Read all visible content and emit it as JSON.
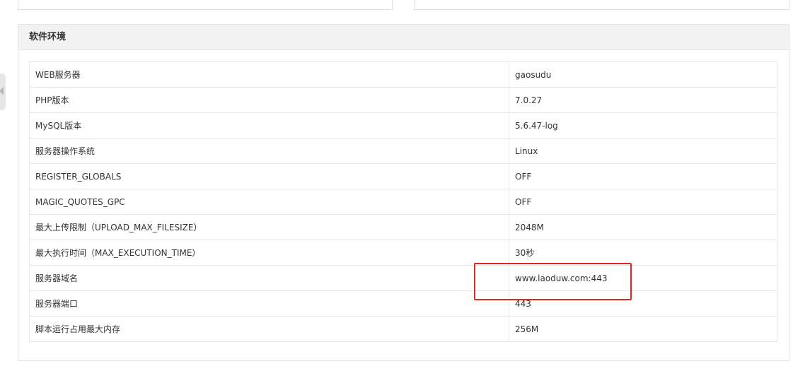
{
  "panel": {
    "title": "软件环境",
    "rows": [
      {
        "key": "WEB服务器",
        "value": "gaosudu"
      },
      {
        "key": "PHP版本",
        "value": "7.0.27"
      },
      {
        "key": "MySQL版本",
        "value": "5.6.47-log"
      },
      {
        "key": "服务器操作系统",
        "value": "Linux"
      },
      {
        "key": "REGISTER_GLOBALS",
        "value": "OFF"
      },
      {
        "key": "MAGIC_QUOTES_GPC",
        "value": "OFF"
      },
      {
        "key": "最大上传限制（UPLOAD_MAX_FILESIZE）",
        "value": "2048M"
      },
      {
        "key": "最大执行时间（MAX_EXECUTION_TIME）",
        "value": "30秒"
      },
      {
        "key": "服务器域名",
        "value": "www.laoduw.com:443"
      },
      {
        "key": "服务器端口",
        "value": "443"
      },
      {
        "key": "脚本运行占用最大内存",
        "value": "256M"
      }
    ]
  },
  "colors": {
    "highlight": "#e0281e",
    "header_bg": "#f2f2f2",
    "border": "#e6e6e6"
  },
  "icons": {
    "side_toggle": "chevron-left-icon"
  }
}
